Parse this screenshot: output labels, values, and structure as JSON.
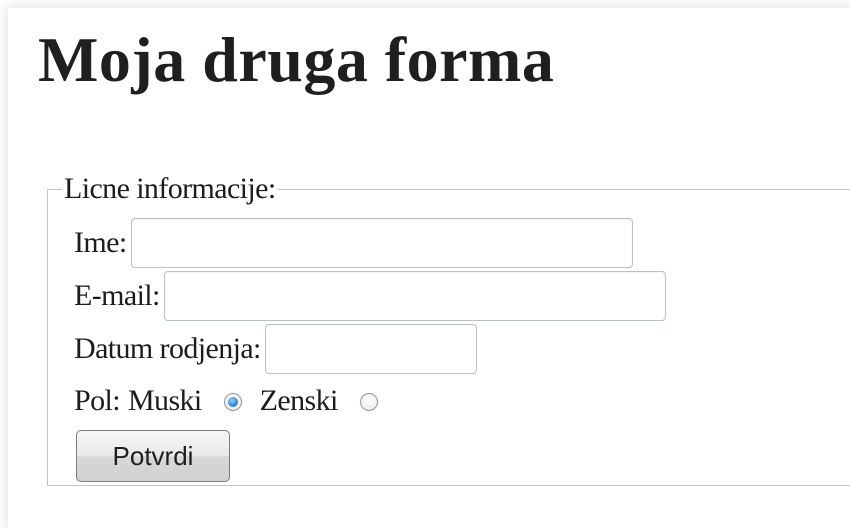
{
  "page": {
    "title": "Moja druga forma"
  },
  "form": {
    "legend": "Licne informacije:",
    "fields": {
      "ime": {
        "label": "Ime:",
        "value": ""
      },
      "email": {
        "label": "E-mail:",
        "value": ""
      },
      "datum": {
        "label": "Datum rodjenja:",
        "value": ""
      }
    },
    "pol": {
      "label": "Pol:",
      "options": [
        {
          "label": "Muski",
          "checked": true
        },
        {
          "label": "Zenski",
          "checked": false
        }
      ]
    },
    "submit_label": "Potvrdi"
  },
  "colors": {
    "radio_checked": "#2a78c7",
    "input_border": "#b8bfc7"
  }
}
